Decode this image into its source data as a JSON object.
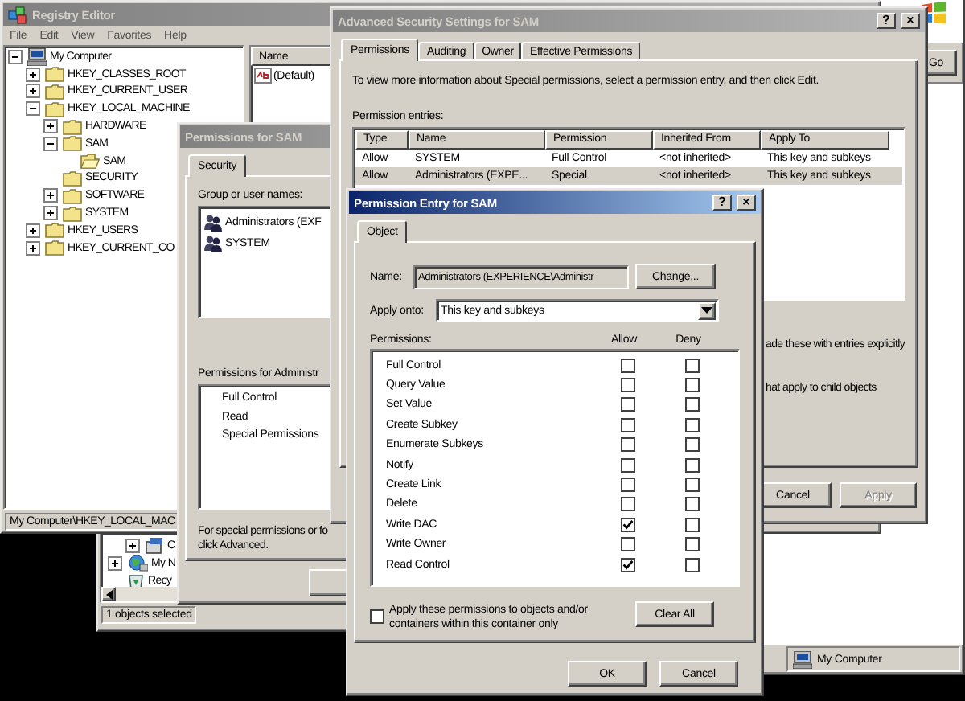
{
  "explorer_window": {
    "go_button": "Go",
    "status": "My Computer"
  },
  "registry_editor": {
    "title": "Registry Editor",
    "active": false,
    "menu": [
      "File",
      "Edit",
      "View",
      "Favorites",
      "Help"
    ],
    "tree": [
      {
        "label": "My Computer",
        "kind": "computer",
        "expanded": true,
        "children": [
          {
            "label": "HKEY_CLASSES_ROOT",
            "kind": "folder",
            "expanded": false
          },
          {
            "label": "HKEY_CURRENT_USER",
            "kind": "folder",
            "expanded": false
          },
          {
            "label": "HKEY_LOCAL_MACHINE",
            "kind": "folder",
            "expanded": true,
            "children": [
              {
                "label": "HARDWARE",
                "kind": "folder",
                "expanded": false
              },
              {
                "label": "SAM",
                "kind": "folder",
                "expanded": true,
                "children": [
                  {
                    "label": "SAM",
                    "kind": "open-folder"
                  }
                ]
              },
              {
                "label": "SECURITY",
                "kind": "folder"
              },
              {
                "label": "SOFTWARE",
                "kind": "folder",
                "expanded": false
              },
              {
                "label": "SYSTEM",
                "kind": "folder",
                "expanded": false
              }
            ]
          },
          {
            "label": "HKEY_USERS",
            "kind": "folder",
            "expanded": false
          },
          {
            "label": "HKEY_CURRENT_CO",
            "kind": "folder",
            "expanded": false
          }
        ]
      }
    ],
    "columns": [
      "Name"
    ],
    "values": [
      "(Default)"
    ],
    "status": "My Computer\\HKEY_LOCAL_MAC"
  },
  "explorer_tree_window": {
    "tree": [
      {
        "label": "C",
        "kind": "drive",
        "expanded": false
      },
      {
        "label": "My N",
        "kind": "network",
        "expanded": false
      },
      {
        "label": "Recy",
        "kind": "recycle-bin"
      }
    ],
    "status": "1 objects selected"
  },
  "permissions_dialog": {
    "title": "Permissions for SAM",
    "active": false,
    "tabs": [
      {
        "label": "Security",
        "selected": true
      }
    ],
    "group_label": "Group or user names:",
    "users": [
      "Administrators (EXF",
      "SYSTEM"
    ],
    "permissions_label": "Permissions for Administr",
    "permissions": [
      "Full Control",
      "Read",
      "Special Permissions"
    ],
    "note": [
      "For special permissions or fo",
      "click Advanced."
    ]
  },
  "advanced_dialog": {
    "title": "Advanced Security Settings for SAM",
    "active": false,
    "title_buttons": [
      "?",
      "×"
    ],
    "tabs": [
      {
        "label": "Permissions",
        "selected": true
      },
      {
        "label": "Auditing",
        "selected": false
      },
      {
        "label": "Owner",
        "selected": false
      },
      {
        "label": "Effective Permissions",
        "selected": false
      }
    ],
    "info": "To view more information about Special permissions, select a permission entry, and then click Edit.",
    "entries_label": "Permission entries:",
    "columns": [
      "Type",
      "Name",
      "Permission",
      "Inherited From",
      "Apply To"
    ],
    "rows": [
      {
        "cells": [
          "Allow",
          "SYSTEM",
          "Full Control",
          "<not inherited>",
          "This key and subkeys"
        ],
        "selected": false
      },
      {
        "cells": [
          "Allow",
          "Administrators (EXPE...",
          "Special",
          "<not inherited>",
          "This key and subkeys"
        ],
        "selected": true
      }
    ],
    "notes": [
      "ade these with entries explicitly",
      "hat apply to child objects"
    ],
    "buttons": [
      {
        "label": "Cancel",
        "disabled": false
      },
      {
        "label": "Apply",
        "disabled": true
      }
    ]
  },
  "entry_dialog": {
    "title": "Permission Entry for SAM",
    "active": true,
    "title_buttons": [
      "?",
      "×"
    ],
    "tabs": [
      {
        "label": "Object",
        "selected": true
      }
    ],
    "name_label": "Name:",
    "name_value": "Administrators (EXPERIENCE\\Administr",
    "change_button": "Change...",
    "apply_label": "Apply onto:",
    "apply_value": "This key and subkeys",
    "permissions_label": "Permissions:",
    "allow_label": "Allow",
    "deny_label": "Deny",
    "permissions": [
      {
        "name": "Full Control",
        "allow": false,
        "deny": false
      },
      {
        "name": "Query Value",
        "allow": false,
        "deny": false
      },
      {
        "name": "Set Value",
        "allow": false,
        "deny": false
      },
      {
        "name": "Create Subkey",
        "allow": false,
        "deny": false
      },
      {
        "name": "Enumerate Subkeys",
        "allow": false,
        "deny": false
      },
      {
        "name": "Notify",
        "allow": false,
        "deny": false
      },
      {
        "name": "Create Link",
        "allow": false,
        "deny": false
      },
      {
        "name": "Delete",
        "allow": false,
        "deny": false
      },
      {
        "name": "Write DAC",
        "allow": true,
        "deny": false
      },
      {
        "name": "Write Owner",
        "allow": false,
        "deny": false
      },
      {
        "name": "Read Control",
        "allow": true,
        "deny": false
      }
    ],
    "inherit_option": {
      "label": "Apply these permissions to objects and/or containers within this container only",
      "checked": false
    },
    "clear_button": "Clear All",
    "buttons": [
      "OK",
      "Cancel"
    ]
  }
}
